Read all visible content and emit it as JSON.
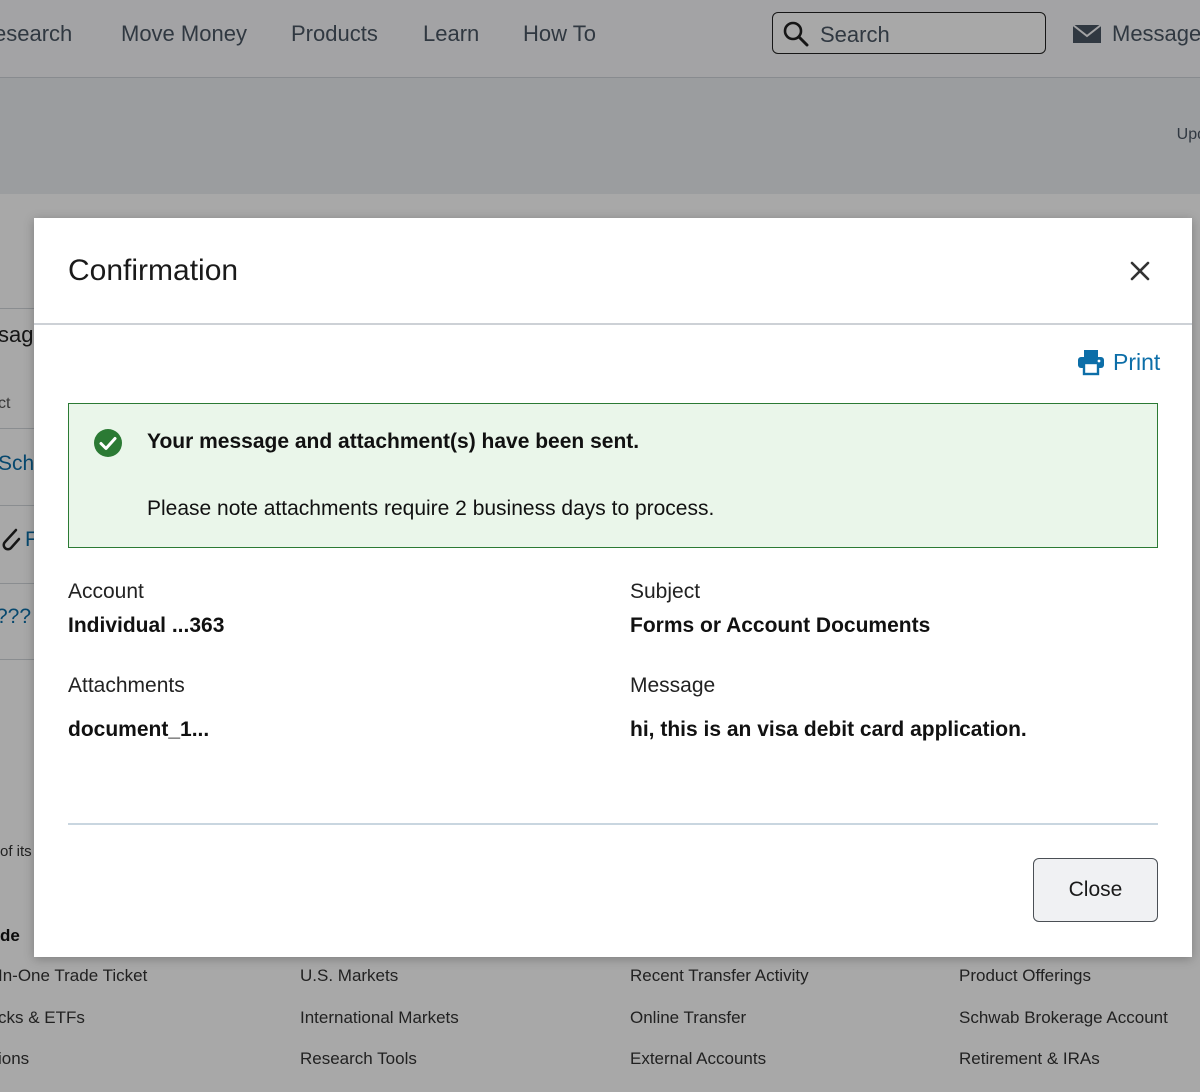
{
  "nav": {
    "items": [
      "esearch",
      "Move Money",
      "Products",
      "Learn",
      "How To"
    ],
    "search_placeholder": "Search",
    "messages_label": "Message"
  },
  "banner": {
    "update_text": "Upd"
  },
  "background": {
    "fragments": [
      "sag",
      "ct",
      "Sch",
      "F",
      "???",
      "of its"
    ],
    "section_heading": "de",
    "footer_columns": [
      [
        "In-One Trade Ticket",
        "cks & ETFs",
        "ions"
      ],
      [
        "U.S. Markets",
        "International Markets",
        "Research Tools"
      ],
      [
        "Recent Transfer Activity",
        "Online Transfer",
        "External Accounts"
      ],
      [
        "Product Offerings",
        "Schwab Brokerage Account",
        "Retirement & IRAs"
      ]
    ]
  },
  "modal": {
    "title": "Confirmation",
    "print_label": "Print",
    "alert": {
      "title": "Your message and attachment(s) have been sent.",
      "body": "Please note attachments require 2 business days to process.",
      "color": "#2b7a34",
      "background": "#eaf6ea"
    },
    "fields": {
      "account_label": "Account",
      "account_value": "Individual ...363",
      "subject_label": "Subject",
      "subject_value": "Forms or Account Documents",
      "attachments_label": "Attachments",
      "attachments_value": "document_1...",
      "message_label": "Message",
      "message_value": "hi, this is an visa debit card application."
    },
    "close_button_label": "Close"
  },
  "colors": {
    "link": "#0c6ea8",
    "success": "#2b7a34"
  }
}
